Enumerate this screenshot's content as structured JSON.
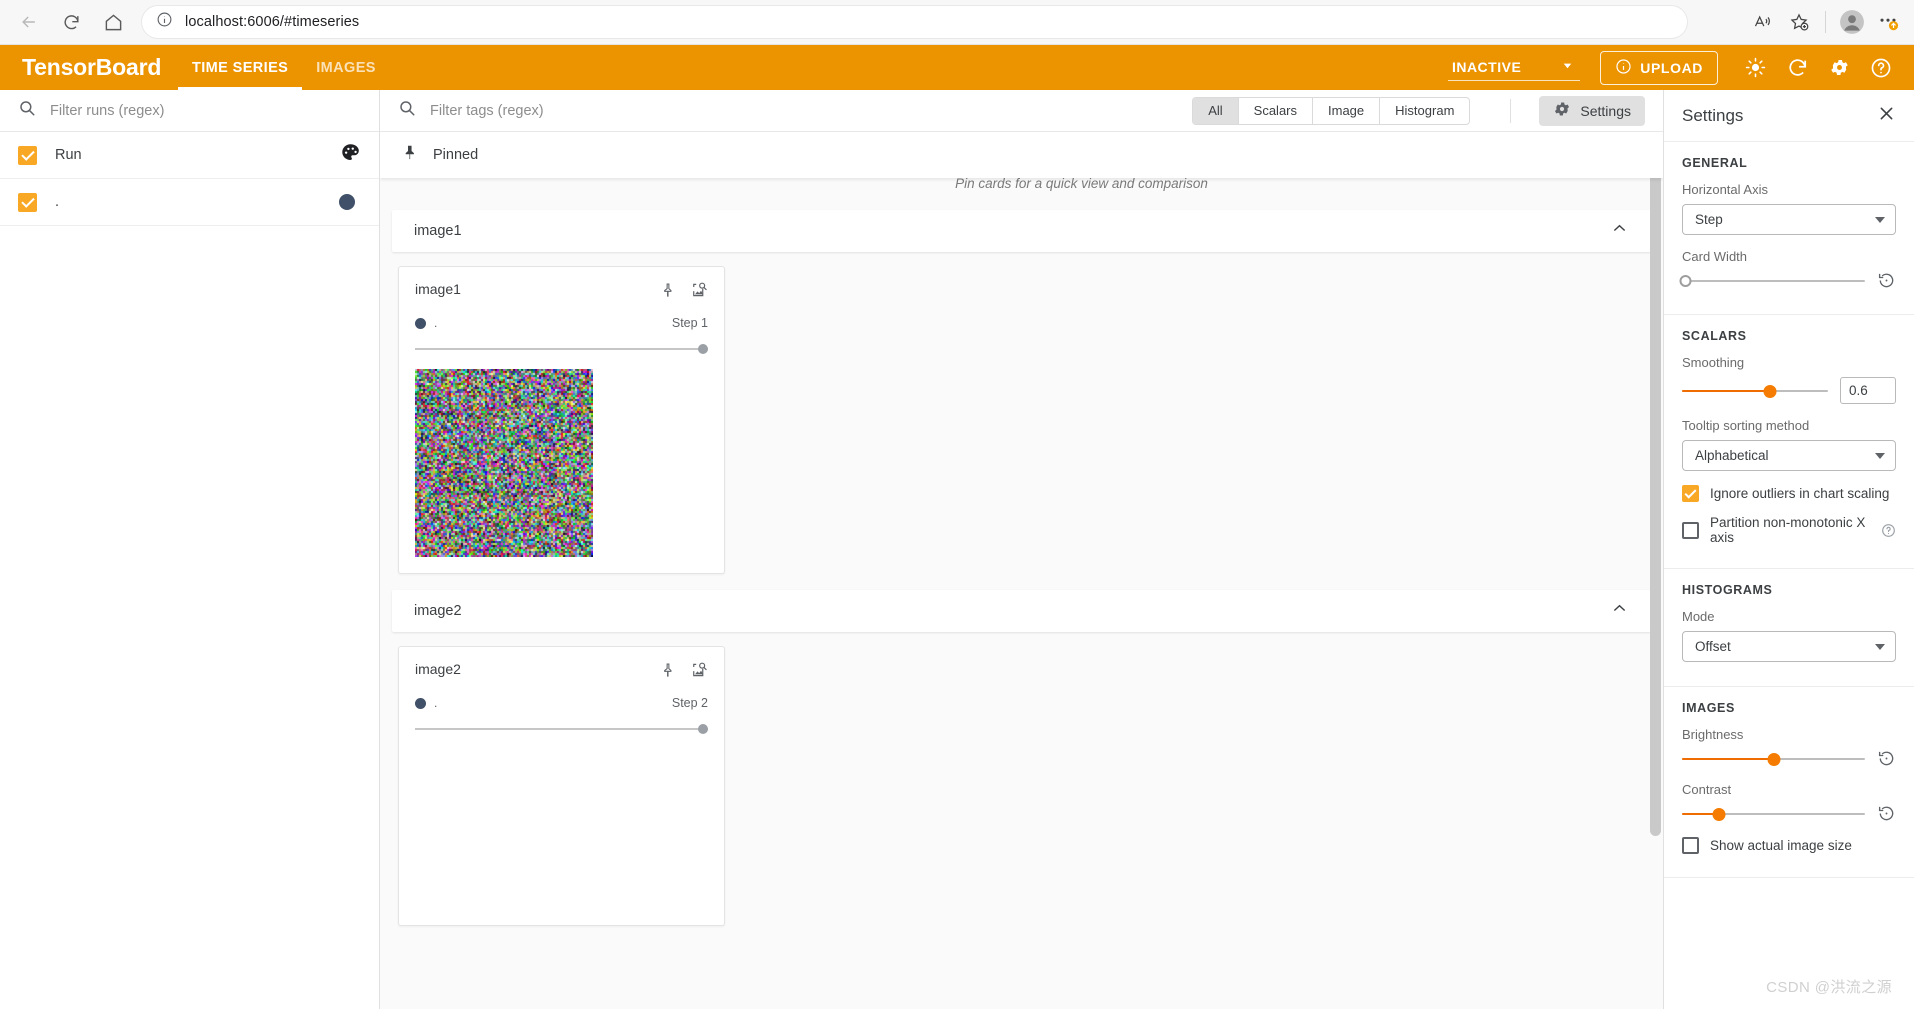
{
  "browser": {
    "url": "localhost:6006/#timeseries",
    "back_icon": "back-arrow-icon",
    "reload_icon": "reload-icon",
    "home_icon": "home-icon",
    "info_icon": "info-circle-icon",
    "read_aloud_icon": "read-aloud-icon",
    "favorite_icon": "add-favorite-icon",
    "profile_icon": "profile-avatar-icon",
    "more_icon": "more-settings-icon"
  },
  "tensorboard": {
    "brand": "TensorBoard",
    "accent_color": "#ec9300",
    "tabs": [
      {
        "label": "TIME SERIES",
        "active": true
      },
      {
        "label": "IMAGES",
        "active": false
      }
    ],
    "run_status": "INACTIVE",
    "upload_label": "UPLOAD",
    "header_icons": [
      "brightness-icon",
      "reload-icon",
      "gear-icon",
      "help-circle-icon"
    ]
  },
  "runs_panel": {
    "filter_placeholder": "Filter runs (regex)",
    "search_icon": "search-icon",
    "rows": [
      {
        "name": "Run",
        "checked": true,
        "marker": "palette-icon",
        "color": "#2f3e55"
      },
      {
        "name": ".",
        "checked": true,
        "marker": "color-dot",
        "color": "#3f5068"
      }
    ]
  },
  "center": {
    "tags_filter_placeholder": "Filter tags (regex)",
    "search_icon": "search-icon",
    "plugin_filters": [
      {
        "label": "All",
        "active": true
      },
      {
        "label": "Scalars",
        "active": false
      },
      {
        "label": "Image",
        "active": false
      },
      {
        "label": "Histogram",
        "active": false
      }
    ],
    "settings_button": "Settings",
    "settings_icon": "gear-icon",
    "pinned_label": "Pinned",
    "pin_icon": "pin-icon",
    "pinned_hint": "Pin cards for a quick view and comparison",
    "groups": [
      {
        "title": "image1",
        "collapse_icon": "chevron-up-icon",
        "card": {
          "title": "image1",
          "pin_icon": "pin-icon",
          "fullscreen_icon": "image-zoom-icon",
          "run_name": ".",
          "run_color": "#3f5068",
          "step_label": "Step 1",
          "has_image": true
        }
      },
      {
        "title": "image2",
        "collapse_icon": "chevron-up-icon",
        "card": {
          "title": "image2",
          "pin_icon": "pin-icon",
          "fullscreen_icon": "image-zoom-icon",
          "run_name": ".",
          "run_color": "#3f5068",
          "step_label": "Step 2",
          "has_image": false
        }
      }
    ]
  },
  "settings": {
    "title": "Settings",
    "close_icon": "close-icon",
    "general": {
      "heading": "GENERAL",
      "horizontal_axis_label": "Horizontal Axis",
      "horizontal_axis_value": "Step",
      "card_width_label": "Card Width",
      "card_width_percent": 0,
      "reset_icon": "reset-icon"
    },
    "scalars": {
      "heading": "SCALARS",
      "smoothing_label": "Smoothing",
      "smoothing_value": "0.6",
      "smoothing_percent": 60,
      "tooltip_sorting_label": "Tooltip sorting method",
      "tooltip_sorting_value": "Alphabetical",
      "ignore_outliers_label": "Ignore outliers in chart scaling",
      "ignore_outliers_checked": true,
      "partition_label": "Partition non-monotonic X axis",
      "partition_checked": false,
      "help_icon": "help-circle-icon"
    },
    "histograms": {
      "heading": "HISTOGRAMS",
      "mode_label": "Mode",
      "mode_value": "Offset"
    },
    "images": {
      "heading": "IMAGES",
      "brightness_label": "Brightness",
      "brightness_percent": 50,
      "contrast_label": "Contrast",
      "contrast_percent": 20,
      "show_actual_size_label": "Show actual image size",
      "show_actual_size_checked": false,
      "reset_icon": "reset-icon"
    }
  },
  "watermark": "CSDN @洪流之源"
}
